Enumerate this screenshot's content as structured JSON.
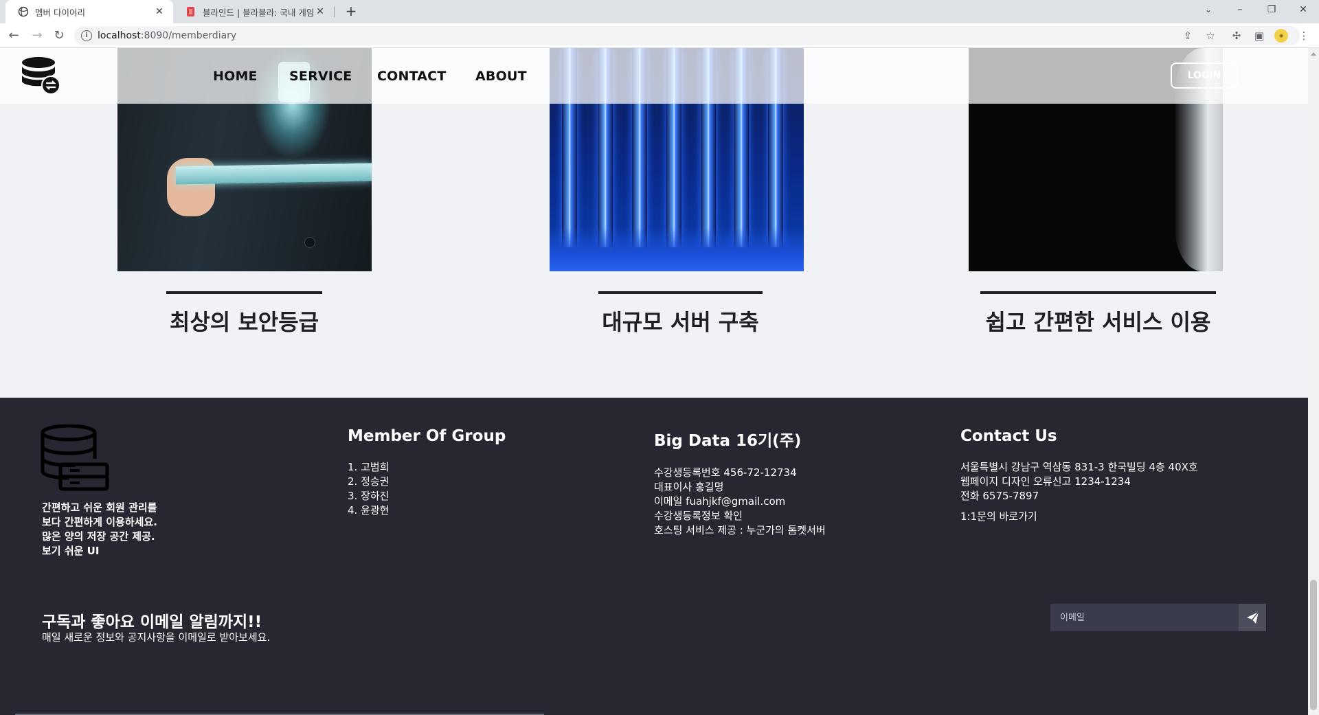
{
  "browser": {
    "tabs": [
      {
        "title": "멤버 다이어리",
        "active": true
      },
      {
        "title": "블라인드 | 블라블라: 국내 게임회",
        "active": false
      }
    ],
    "url_host": "localhost",
    "url_rest": ":8090/memberdiary",
    "new_tab_label": "+",
    "window_controls": {
      "minimize": "–",
      "maximize": "❐",
      "close": "✕"
    }
  },
  "header": {
    "nav": [
      "HOME",
      "SERVICE",
      "CONTACT",
      "ABOUT"
    ],
    "login_label": "LOGIN"
  },
  "services": [
    {
      "title": "최상의 보안등급",
      "image": "security-hand-tablet"
    },
    {
      "title": "대규모 서버 구축",
      "image": "server-racks"
    },
    {
      "title": "쉽고 간편한 서비스 이용",
      "image": "dark-shore-wave"
    }
  ],
  "footer": {
    "description": [
      "간편하고 쉬운 회원 관리를",
      "보다 간편하게 이용하세요.",
      "많은 양의 저장 공간 제공.",
      "보기 쉬운 UI"
    ],
    "members": {
      "heading": "Member Of Group",
      "items": [
        "1. 고범희",
        "2. 정승권",
        "3. 장하진",
        "4. 윤광현"
      ]
    },
    "company": {
      "heading": "Big Data 16기(주)",
      "lines": [
        "수강생등록번호 456-72-12734",
        "대표이사 홍길명",
        "이메일 fuahjkf@gmail.com",
        "수강생등록정보 확인",
        "호스팅 서비스 제공 : 누군가의 톰켓서버"
      ]
    },
    "contact": {
      "heading": "Contact Us",
      "lines": [
        "서울특별시 강남구 역삼동 831-3 한국빌딩 4층 40X호",
        "웹페이지 디자인 오류신고 1234-1234",
        "전화 6575-7897"
      ],
      "inquiry_link": "1:1문의 바로가기"
    },
    "subscribe": {
      "title": "구독과 좋아요 이메일 알림까지!!",
      "subtitle": "매일 새로운 정보와 공지사항을 이메일로 받아보세요.",
      "email_placeholder": "이메일"
    }
  },
  "colors": {
    "footer_bg": "#262730",
    "page_bg": "#f1f2f6",
    "text_dark": "#1e1f23",
    "email_input_bg": "#3a3c4e"
  }
}
